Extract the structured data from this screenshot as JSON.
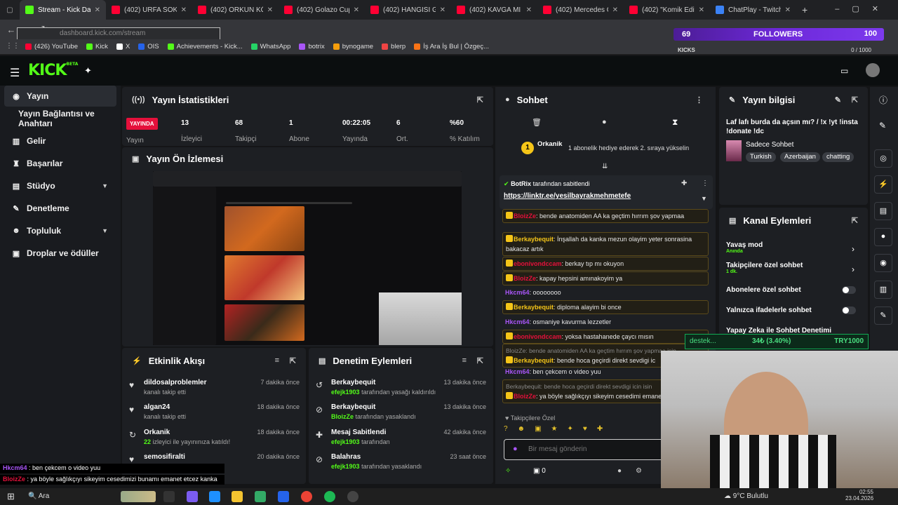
{
  "browser": {
    "tabs": [
      {
        "label": "Stream - Kick Dashb",
        "color": "#53fc18",
        "active": true
      },
      {
        "label": "(402) URFA SOKAK L",
        "color": "#ff0033"
      },
      {
        "label": "(402) ORKUN KÖKÇÜ",
        "color": "#ff0033"
      },
      {
        "label": "(402) Golazo Cup Tü",
        "color": "#ff0033"
      },
      {
        "label": "(402) HANGİSİ GERÇ",
        "color": "#ff0033"
      },
      {
        "label": "(402) KAVGA MI EDE",
        "color": "#ff0033"
      },
      {
        "label": "(402) Mercedes C Se",
        "color": "#ff0033"
      },
      {
        "label": "(402) \"Komik Editli V",
        "color": "#ff0033"
      },
      {
        "label": "ChatPlay - Twitch & K",
        "color": "#3b82f6"
      }
    ],
    "url": "dashboard.kick.com/stream",
    "bookmarks": [
      {
        "label": "(426) YouTube",
        "color": "#ff0033"
      },
      {
        "label": "Kick",
        "color": "#53fc18"
      },
      {
        "label": "X",
        "color": "#ffffff"
      },
      {
        "label": "OIS",
        "color": "#2563eb"
      },
      {
        "label": "Achievements - Kick...",
        "color": "#53fc18"
      },
      {
        "label": "WhatsApp",
        "color": "#25d366"
      },
      {
        "label": "botrix",
        "color": "#a855f7"
      },
      {
        "label": "bynogame",
        "color": "#f59e0b"
      },
      {
        "label": "blerp",
        "color": "#ef4444"
      },
      {
        "label": "İş Ara İş Bul | Özgeç...",
        "color": "#f97316"
      }
    ]
  },
  "followers": {
    "count": "69",
    "title": "FOLLOWERS",
    "goal": "100",
    "kicks_label": "KICKS",
    "kicks_ratio": "0 / 1000"
  },
  "logo": {
    "text": "KICK",
    "sup": "BETA"
  },
  "sidebar": {
    "items": [
      {
        "label": "Yayın"
      },
      {
        "label": "Yayın Bağlantısı ve Anahtarı"
      },
      {
        "label": "Gelir"
      },
      {
        "label": "Başarılar"
      },
      {
        "label": "Stüdyo"
      },
      {
        "label": "Denetleme"
      },
      {
        "label": "Topluluk"
      },
      {
        "label": "Droplar ve ödüller"
      }
    ]
  },
  "stats": {
    "title": "Yayın İstatistikleri",
    "live": "YAYINDA",
    "live_label": "Yayın",
    "items": [
      {
        "value": "13",
        "label": "İzleyici"
      },
      {
        "value": "68",
        "label": "Takipçi"
      },
      {
        "value": "1",
        "label": "Abone"
      },
      {
        "value": "00:22:05",
        "label": "Yayında"
      },
      {
        "value": "6",
        "label": "Ort."
      },
      {
        "value": "%60",
        "label": "% Katılım"
      }
    ]
  },
  "preview": {
    "title": "Yayın Ön İzlemesi"
  },
  "activity": {
    "title": "Etkinlik Akışı",
    "rows": [
      {
        "name": "dildosalproblemler",
        "sub": "kanalı takip etti",
        "time": "7 dakika önce"
      },
      {
        "name": "algan24",
        "sub": "kanalı takip etti",
        "time": "18 dakika önce"
      },
      {
        "name": "Orkanik",
        "sub_hl": "22",
        "sub": "izleyici ile yayınınıza katıldı!",
        "time": "18 dakika önce"
      },
      {
        "name": "semosifiralti",
        "sub": "kanalı takip etti",
        "time": "20 dakika önce"
      }
    ]
  },
  "moderation": {
    "title": "Denetim Eylemleri",
    "rows": [
      {
        "name": "Berkaybequit",
        "sub_hl": "efejk1903",
        "sub": "tarafından yasağı kaldırıldı",
        "time": "13 dakika önce"
      },
      {
        "name": "Berkaybequit",
        "sub_hl": "BloizZe",
        "sub": "tarafından yasaklandı",
        "time": "13 dakika önce"
      },
      {
        "name": "Mesaj Sabitlendi",
        "sub_hl": "efejk1903",
        "sub": "tarafından",
        "time": "42 dakika önce"
      },
      {
        "name": "Balahras",
        "sub_hl": "efejk1903",
        "sub": "tarafından yasaklandı",
        "time": "23 saat önce"
      }
    ]
  },
  "chat": {
    "title": "Sohbet",
    "gifter": "Orkanik",
    "gifter_count": "1",
    "gift_text": "1 abonelik hediye ederek 2. sıraya yükselin",
    "pinned_user": "BotRix",
    "pinned_text": "tarafından sabitlendi",
    "pinned_link": "https://linktr.ee/yesilbayrakmehmetefe",
    "messages": [
      {
        "user": "BloizZe",
        "color": "#e5103b",
        "text": "bende anatomiden AA ka geçtim hırrım şov yapmaa",
        "box": true
      },
      {
        "user": "Berkaybequit",
        "color": "#f5c518",
        "text": "İnşallah da kanka mezun olayim yeter sonrasina bakacaz artık",
        "box": true
      },
      {
        "user": "ebonivondccam",
        "color": "#e5103b",
        "text": "berkay tıp mı okuyon",
        "box": true
      },
      {
        "user": "BloizZe",
        "color": "#e5103b",
        "text": "kapay hepsini amınakoyim ya",
        "box": true
      },
      {
        "user": "Hkcm64",
        "color": "#a855f7",
        "text": "oooooooo",
        "box": false
      },
      {
        "user": "Berkaybequit",
        "color": "#f5c518",
        "text": "diploma alayim bi once",
        "box": true
      },
      {
        "user": "Hkcm64",
        "color": "#a855f7",
        "text": "osmaniye kavurma lezzetler",
        "box": false
      },
      {
        "user": "ebonivondccam",
        "color": "#e5103b",
        "text": "yoksa hastahanede çaycı mısın",
        "box": true
      },
      {
        "user": "Berkaybequit",
        "color": "#f5c518",
        "text": "bende hoca geçirdi direkt sevdigi ic",
        "box": true,
        "reply": "BloizZe: bende anatomiden AA ka geçtim hırrım şov yapmaa isin"
      },
      {
        "user": "Hkcm64",
        "color": "#a855f7",
        "text": "ben çekcem o video yuu",
        "box": false
      },
      {
        "user": "BloizZe",
        "color": "#e5103b",
        "text": "ya böyle sağlıkçıyı sikeyim cesedimi emanet etcez kanka",
        "box": true,
        "reply": "Berkaybequit: bende hoca geçirdi direkt sevdigi icin isin"
      }
    ],
    "followers_only": "Takipçilere Özel",
    "input_placeholder": "Bir mesaj gönderin",
    "points": "0"
  },
  "stream_info": {
    "title": "Yayın bilgisi",
    "desc": "Laf lafı burda da açsın mı? / !x !yt !insta !donate !dc",
    "category": "Sadece Sohbet",
    "tags": [
      "Turkish",
      "Azerbaijan",
      "chatting"
    ]
  },
  "channel_actions": {
    "title": "Kanal Eylemleri",
    "items": [
      {
        "label": "Yavaş mod",
        "sub": "Anında",
        "type": "arrow"
      },
      {
        "label": "Takipçilere özel sohbet",
        "sub": "1 dk.",
        "type": "arrow"
      },
      {
        "label": "Abonelere özel sohbet",
        "type": "toggle"
      },
      {
        "label": "Yalnızca ifadelerle sohbet",
        "type": "toggle"
      },
      {
        "label": "Yapay Zeka ile Sohbet Denetimi",
        "type": "link"
      }
    ]
  },
  "donate_bar": {
    "name": "destek...",
    "amount": "34₺ (3.40%)",
    "goal": "TRY1000"
  },
  "tickers": [
    {
      "user": "Hkcm64",
      "text": "ben çekcem o video yuu"
    },
    {
      "user": "BloizZe",
      "text": "ya böyle sağlıkçıyı sikeyim cesedimizi bunamı emanet etcez kanka"
    }
  ],
  "taskbar": {
    "search": "Ara",
    "weather": "9°C Bulutlu",
    "time": "02:55",
    "date": "23.04.2026"
  }
}
